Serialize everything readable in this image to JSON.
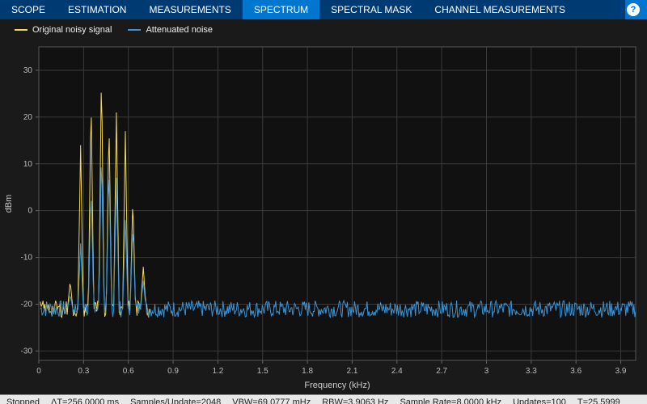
{
  "tabs": [
    {
      "label": "SCOPE"
    },
    {
      "label": "ESTIMATION"
    },
    {
      "label": "MEASUREMENTS"
    },
    {
      "label": "SPECTRUM",
      "active": true
    },
    {
      "label": "SPECTRAL MASK"
    },
    {
      "label": "CHANNEL MEASUREMENTS"
    }
  ],
  "help_label": "?",
  "legend": {
    "series_a": {
      "label": "Original noisy signal",
      "color": "#f5d951"
    },
    "series_b": {
      "label": "Attenuated noise",
      "color": "#3b93d6"
    }
  },
  "axes": {
    "xlabel": "Frequency (kHz)",
    "ylabel": "dBm",
    "xlim": [
      0,
      4.0
    ],
    "ylim": [
      -32,
      35
    ],
    "xticks": [
      0,
      0.3,
      0.6,
      0.9,
      1.2,
      1.5,
      1.8,
      2.1,
      2.4,
      2.7,
      3,
      3.3,
      3.6,
      3.9
    ],
    "yticks": [
      -30,
      -20,
      -10,
      0,
      10,
      20,
      30
    ]
  },
  "status": {
    "state": "Stopped",
    "dt": "ΔT=256.0000 ms",
    "spu": "Samples/Update=2048",
    "vbw": "VBW=69.0777 mHz",
    "rbw": "RBW=3.9063 Hz",
    "srate": "Sample Rate=8.0000 kHz",
    "updates": "Updates=100",
    "t": "T=25.5999"
  },
  "chart_data": {
    "type": "line",
    "xlabel": "Frequency (kHz)",
    "ylabel": "dBm",
    "xlim": [
      0,
      4.0
    ],
    "ylim": [
      -32,
      35
    ],
    "noise_floor_db": -21,
    "noise_amplitude_db": 1.8,
    "series": [
      {
        "name": "Original noisy signal",
        "color": "#f5d951",
        "peaks": [
          {
            "freq_khz": 0.21,
            "db": -15
          },
          {
            "freq_khz": 0.28,
            "db": 14
          },
          {
            "freq_khz": 0.35,
            "db": 25
          },
          {
            "freq_khz": 0.42,
            "db": 31
          },
          {
            "freq_khz": 0.47,
            "db": 20
          },
          {
            "freq_khz": 0.52,
            "db": 21
          },
          {
            "freq_khz": 0.58,
            "db": 17
          },
          {
            "freq_khz": 0.63,
            "db": 3
          },
          {
            "freq_khz": 0.7,
            "db": -12
          }
        ],
        "visible_range_khz": [
          0,
          0.75
        ]
      },
      {
        "name": "Attenuated noise",
        "color": "#3b93d6",
        "peaks": [
          {
            "freq_khz": 0.21,
            "db": -18
          },
          {
            "freq_khz": 0.28,
            "db": -7
          },
          {
            "freq_khz": 0.35,
            "db": 5
          },
          {
            "freq_khz": 0.42,
            "db": 13
          },
          {
            "freq_khz": 0.47,
            "db": 10
          },
          {
            "freq_khz": 0.52,
            "db": 7
          },
          {
            "freq_khz": 0.58,
            "db": -2
          },
          {
            "freq_khz": 0.63,
            "db": -3
          },
          {
            "freq_khz": 0.7,
            "db": -15
          }
        ],
        "visible_range_khz": [
          0,
          4.0
        ]
      }
    ]
  }
}
